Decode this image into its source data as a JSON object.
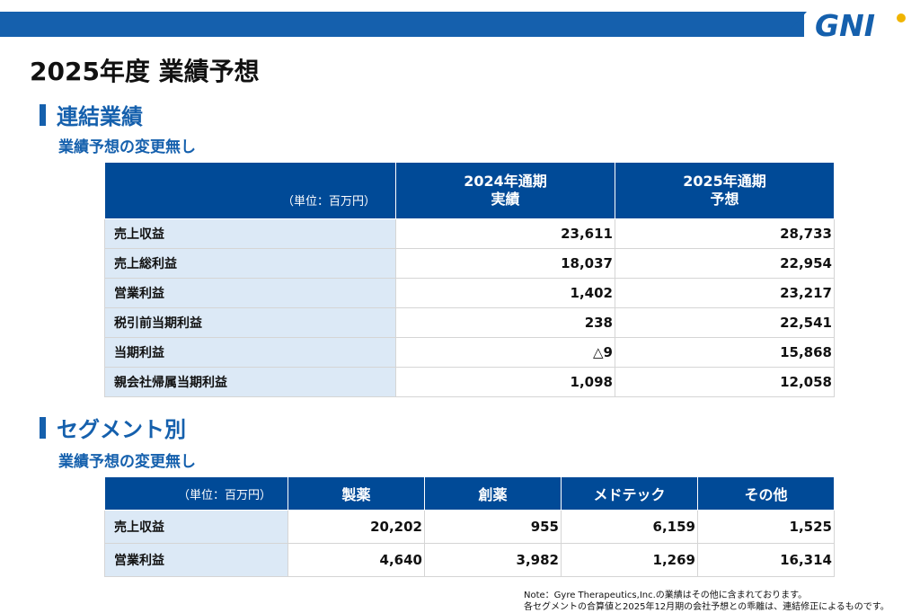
{
  "header": {
    "logo_text": "GNI",
    "colors": {
      "brand_blue": "#1560ad",
      "table_header": "#004a97",
      "label_bg": "#dce9f6",
      "logo_accent": "#f0b400"
    }
  },
  "page_title": "2025年度 業績予想",
  "consolidated": {
    "section_title": "連結業績",
    "subtitle": "業績予想の変更無し",
    "unit_label": "（単位：百万円）",
    "col1_label": "2024年通期\n実績",
    "col2_label": "2025年通期\n予想",
    "rows": [
      {
        "label": "売上収益",
        "v2024": "23,611",
        "v2025": "28,733"
      },
      {
        "label": "売上総利益",
        "v2024": "18,037",
        "v2025": "22,954"
      },
      {
        "label": "営業利益",
        "v2024": "1,402",
        "v2025": "23,217"
      },
      {
        "label": "税引前当期利益",
        "v2024": "238",
        "v2025": "22,541"
      },
      {
        "label": "当期利益",
        "v2024": "△9",
        "v2025": "15,868"
      },
      {
        "label": "親会社帰属当期利益",
        "v2024": "1,098",
        "v2025": "12,058"
      }
    ]
  },
  "segment": {
    "section_title": "セグメント別",
    "subtitle": "業績予想の変更無し",
    "unit_label": "（単位：百万円）",
    "columns": [
      "製薬",
      "創薬",
      "メドテック",
      "その他"
    ],
    "rows": [
      {
        "label": "売上収益",
        "values": [
          "20,202",
          "955",
          "6,159",
          "1,525"
        ]
      },
      {
        "label": "営業利益",
        "values": [
          "4,640",
          "3,982",
          "1,269",
          "16,314"
        ]
      }
    ]
  },
  "note": {
    "line1": "Note：Gyre Therapeutics,Inc.の業績はその他に含まれております。",
    "line2": "各セグメントの合算値と2025年12月期の会社予想との乖離は、連結修正によるものです。"
  }
}
